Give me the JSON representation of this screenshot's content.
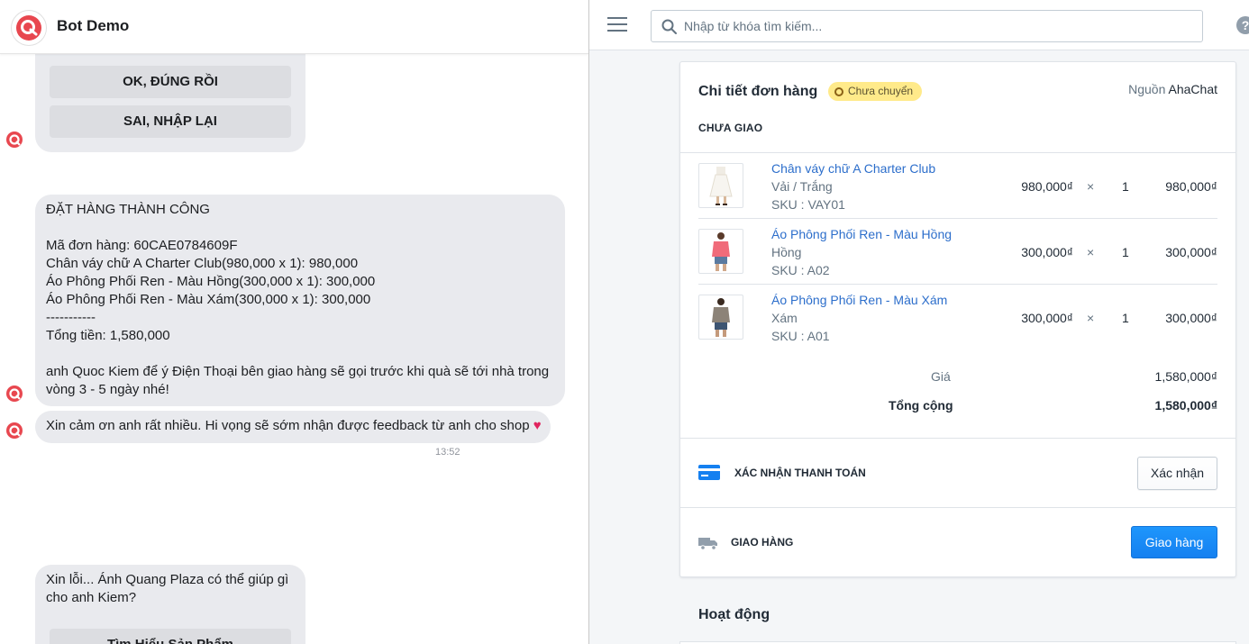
{
  "chat": {
    "title": "Bot Demo",
    "quick_replies_top": [
      "OK, ĐÚNG RỒI",
      "SAI, NHẬP LẠI"
    ],
    "order_confirmation": "ĐẶT HÀNG THÀNH CÔNG\n\nMã đơn hàng: 60CAE0784609F\nChân váy chữ A Charter Club(980,000 x 1): 980,000\nÁo Phông Phối Ren - Màu Hồng(300,000 x 1): 300,000\nÁo Phông Phối Ren - Màu Xám(300,000 x 1): 300,000\n-----------\nTổng tiền: 1,580,000\n\nanh Quoc Kiem để ý Điện Thoại bên giao hàng sẽ gọi trước khi quà sẽ tới nhà trong vòng 3 - 5 ngày nhé!",
    "thanks_message": "Xin cảm ơn anh rất nhiều. Hi vọng sẽ sớm nhận được feedback từ anh cho shop",
    "thanks_emoji": "❤️",
    "timestamp": "13:52",
    "sorry_message": "Xin lỗi... Ánh Quang Plaza có thể giúp gì cho anh Kiem?",
    "quick_reply_bottom": "Tìm Hiểu Sản Phẩm"
  },
  "topbar": {
    "search_placeholder": "Nhập từ khóa tìm kiếm...",
    "help_symbol": "?"
  },
  "order": {
    "title": "Chi tiết đơn hàng",
    "status": "Chưa chuyển",
    "source_prefix": "Nguồn",
    "source_name": "AhaChat",
    "section_label": "CHƯA GIAO",
    "items": [
      {
        "name": "Chân váy chữ A Charter Club",
        "variant": "Vải / Trắng",
        "sku": "SKU : VAY01",
        "price": "980,000₫",
        "times": "×",
        "qty": "1",
        "total": "980,000₫"
      },
      {
        "name": "Áo Phông Phối Ren - Màu Hồng",
        "variant": "Hồng",
        "sku": "SKU : A02",
        "price": "300,000₫",
        "times": "×",
        "qty": "1",
        "total": "300,000₫"
      },
      {
        "name": "Áo Phông Phối Ren - Màu Xám",
        "variant": "Xám",
        "sku": "SKU : A01",
        "price": "300,000₫",
        "times": "×",
        "qty": "1",
        "total": "300,000₫"
      }
    ],
    "subtotal_label": "Giá",
    "subtotal_value": "1,580,000₫",
    "total_label": "Tổng cộng",
    "total_value": "1,580,000₫",
    "payment_label": "XÁC NHẬN THANH TOÁN",
    "payment_button": "Xác nhận",
    "shipping_label": "GIAO HÀNG",
    "shipping_button": "Giao hàng"
  },
  "activity": {
    "title": "Hoạt động"
  },
  "colors": {
    "brand": "#e8474f",
    "accent_link": "#2c6ecb",
    "primary_button": "#1580f0",
    "status_badge": "#ffea8a",
    "chat_bubble": "#e9eaee"
  }
}
